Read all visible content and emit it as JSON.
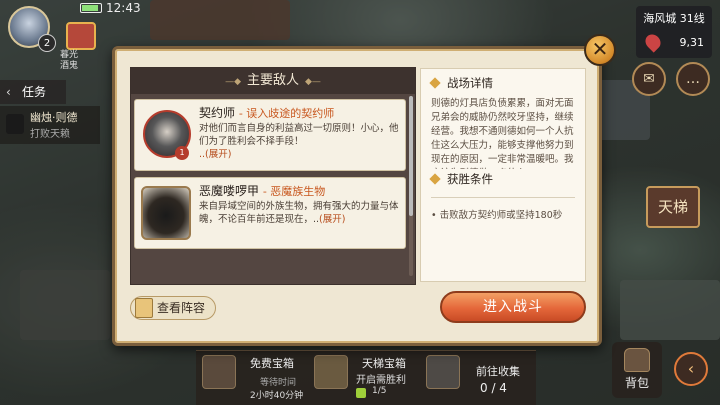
{
  "status": {
    "time": "12:43",
    "avatar_level": "2",
    "shop_label": "暮光\n酒鬼"
  },
  "city": {
    "name": "海风城 31线",
    "coords": "9,31"
  },
  "quest": {
    "tab_label": "任务",
    "item_title": "幽烛·则德",
    "item_sub": "打败天赖"
  },
  "side_button": "天梯",
  "dialog": {
    "left_header": "主要敌人",
    "enemies": [
      {
        "name": "契约师",
        "tag": "- 误入歧途的契约师",
        "desc": "对他们而言自身的利益高过一切原则！小心，他们为了胜利会不择手段！",
        "expand": "..(展开)",
        "badge": "1"
      },
      {
        "name": "恶魔喽啰甲",
        "tag": "- 恶魔族生物",
        "desc": "来自异域空间的外族生物，拥有强大的力量与体魄，不论百年前还是现在，..",
        "expand": "(展开)"
      }
    ],
    "details_title": "战场详情",
    "details_text": "则德的灯具店负债累累，面对无面兄弟会的威胁仍然咬牙坚持，继续经营。我想不通则德如何一个人抗住这么大压力，能够支撑他努力到现在的原因，一定非常温暖吧。我应该为则德做一点什么",
    "conditions_title": "获胜条件",
    "condition": "击败敌方契约师或坚持180秒",
    "lineup_button": "查看阵容",
    "fight_button": "进入战斗",
    "close": "✕"
  },
  "bottom": {
    "free_chest_label": "免费宝箱",
    "free_chest_wait": "等待时间",
    "free_chest_time": "2小时40分钟",
    "ladder_chest_label": "天梯宝箱",
    "ladder_chest_sub": "开启需胜利",
    "ladder_progress": "1/5",
    "collect_label": "前往收集",
    "collect_progress": "0 / 4",
    "bag_label": "背包"
  },
  "colors": {
    "accent": "#e4673a",
    "tag": "#c8571e",
    "panel_dark": "#544641",
    "panel_light": "#fbf7ee"
  }
}
